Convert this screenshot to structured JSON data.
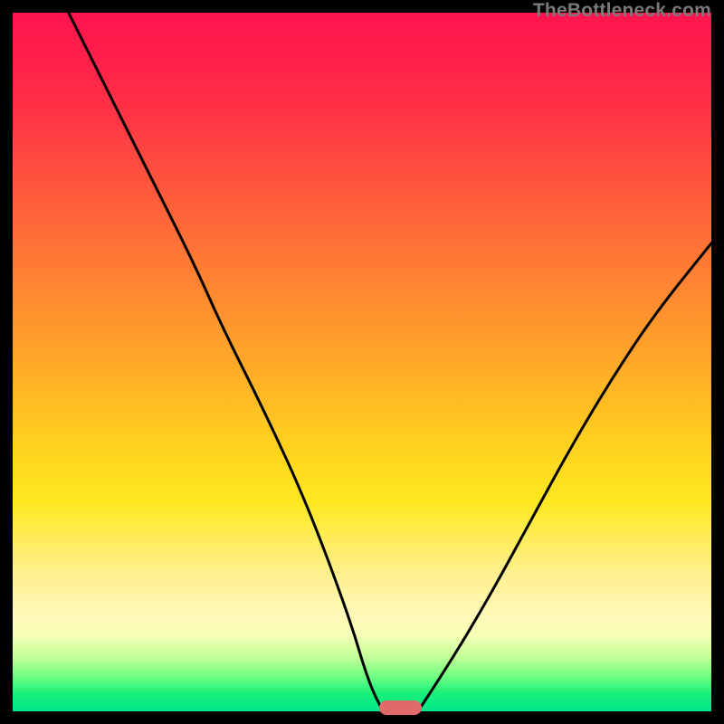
{
  "watermark": "TheBottleneck.com",
  "chart_data": {
    "type": "line",
    "title": "",
    "xlabel": "",
    "ylabel": "",
    "xlim": [
      0,
      100
    ],
    "ylim": [
      0,
      100
    ],
    "grid": false,
    "series": [
      {
        "name": "left-branch",
        "x": [
          8,
          14,
          20,
          26,
          30,
          36,
          42,
          48,
          51,
          53
        ],
        "y": [
          100,
          88,
          76,
          64,
          55,
          43,
          30,
          14,
          4,
          0
        ]
      },
      {
        "name": "right-branch",
        "x": [
          58,
          62,
          68,
          74,
          80,
          86,
          92,
          100
        ],
        "y": [
          0,
          6,
          16,
          27,
          38,
          48,
          57,
          67
        ]
      }
    ],
    "annotations": [
      {
        "name": "optimal-marker",
        "shape": "rounded-bar",
        "x_range": [
          52.5,
          58.5
        ],
        "y": 0.5,
        "color": "#e06a6a"
      }
    ],
    "background_gradient": {
      "direction": "top-to-bottom",
      "stops": [
        {
          "pos": 0.0,
          "color": "#ff1450"
        },
        {
          "pos": 0.5,
          "color": "#ffa828"
        },
        {
          "pos": 0.8,
          "color": "#fff8b8"
        },
        {
          "pos": 1.0,
          "color": "#00e68c"
        }
      ]
    },
    "frame": {
      "color": "#000000",
      "thickness_px": 14
    }
  }
}
